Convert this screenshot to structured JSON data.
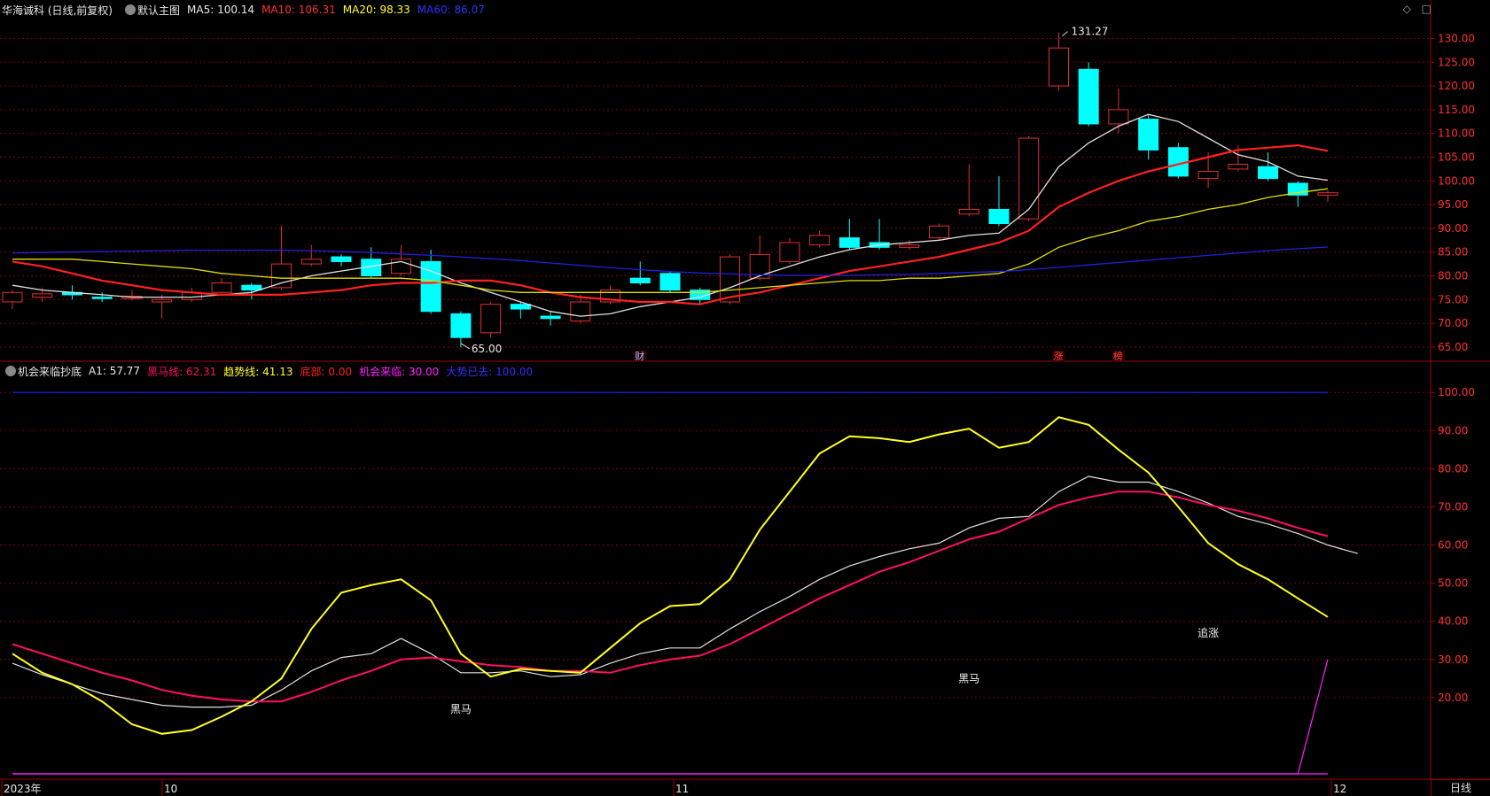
{
  "header": {
    "stock_title": "华海诚科 (日线,前复权)",
    "main_chart_label": "默认主图",
    "ma5": "MA5: 100.14",
    "ma10": "MA10: 106.31",
    "ma20": "MA20: 98.33",
    "ma60": "MA60: 86.07",
    "icons": [
      "diamond-icon",
      "square-icon"
    ]
  },
  "indicator": {
    "name": "机会来临抄底",
    "a1": "A1: 57.77",
    "heima": "黑马线: 62.31",
    "trend": "趋势线: 41.13",
    "bottom": "底部: 0.00",
    "chance": "机会来临: 30.00",
    "gone": "大势已去: 100.00"
  },
  "colors": {
    "bg": "#000000",
    "grid": "#7a0000",
    "axis": "#a00000",
    "up": "#e03030",
    "down": "#00ffff",
    "ma5": "#e0e0e0",
    "ma10": "#ff2020",
    "ma20": "#e0e000",
    "ma60": "#2020e0",
    "a1": "#e0e0e0",
    "heima": "#ff1060",
    "trend": "#ffff20",
    "chance": "#ff20ff",
    "gone": "#2020ff",
    "bottom_line": "#ff20ff"
  },
  "time_axis": {
    "labels": [
      "2023年",
      "10",
      "11",
      "12"
    ],
    "period_label": "日线"
  },
  "chart_data": [
    {
      "type": "candlestick",
      "title": "华海诚科 (日线,前复权)",
      "ylim": [
        62,
        134
      ],
      "y_ticks": [
        65,
        70,
        75,
        80,
        85,
        90,
        95,
        100,
        105,
        110,
        115,
        120,
        125,
        130
      ],
      "annotations": {
        "high": "131.27",
        "low": "65.00",
        "markers": [
          "财",
          "涨",
          "榜"
        ]
      },
      "candles": [
        {
          "o": 74.5,
          "c": 76.5,
          "h": 77,
          "l": 73
        },
        {
          "o": 75.5,
          "c": 76.2,
          "h": 77.5,
          "l": 74.5
        },
        {
          "o": 76.5,
          "c": 76,
          "h": 78,
          "l": 75
        },
        {
          "o": 75.5,
          "c": 75.2,
          "h": 76.5,
          "l": 74.5
        },
        {
          "o": 75.2,
          "c": 75.7,
          "h": 77,
          "l": 74.8
        },
        {
          "o": 74.5,
          "c": 75,
          "h": 76,
          "l": 71
        },
        {
          "o": 75,
          "c": 76.5,
          "h": 77.5,
          "l": 74.5
        },
        {
          "o": 76.5,
          "c": 78.5,
          "h": 79.5,
          "l": 76
        },
        {
          "o": 78,
          "c": 77,
          "h": 78.5,
          "l": 75
        },
        {
          "o": 77.5,
          "c": 82.5,
          "h": 90.5,
          "l": 77
        },
        {
          "o": 82.5,
          "c": 83.5,
          "h": 86.5,
          "l": 82
        },
        {
          "o": 84,
          "c": 83,
          "h": 84.5,
          "l": 82
        },
        {
          "o": 83.5,
          "c": 80,
          "h": 86,
          "l": 79.5
        },
        {
          "o": 80.5,
          "c": 83.5,
          "h": 86.5,
          "l": 80
        },
        {
          "o": 83,
          "c": 72.5,
          "h": 85.5,
          "l": 72
        },
        {
          "o": 72,
          "c": 67,
          "h": 72.5,
          "l": 65
        },
        {
          "o": 68,
          "c": 74,
          "h": 74.5,
          "l": 67
        },
        {
          "o": 74,
          "c": 73,
          "h": 74.5,
          "l": 71
        },
        {
          "o": 71.5,
          "c": 71,
          "h": 72.5,
          "l": 69.5
        },
        {
          "o": 70.5,
          "c": 74.5,
          "h": 76,
          "l": 70
        },
        {
          "o": 74.5,
          "c": 77,
          "h": 78,
          "l": 74
        },
        {
          "o": 79.5,
          "c": 78.5,
          "h": 83,
          "l": 78
        },
        {
          "o": 80.5,
          "c": 77,
          "h": 81,
          "l": 76.5
        },
        {
          "o": 77,
          "c": 75,
          "h": 77.5,
          "l": 74
        },
        {
          "o": 74.5,
          "c": 84,
          "h": 84.5,
          "l": 74
        },
        {
          "o": 79.5,
          "c": 84.5,
          "h": 88.5,
          "l": 79
        },
        {
          "o": 83,
          "c": 87,
          "h": 88,
          "l": 82.5
        },
        {
          "o": 86.5,
          "c": 88.5,
          "h": 89.5,
          "l": 86
        },
        {
          "o": 88,
          "c": 86,
          "h": 92,
          "l": 85.5
        },
        {
          "o": 87,
          "c": 86,
          "h": 92,
          "l": 85.5
        },
        {
          "o": 86,
          "c": 86.5,
          "h": 87.5,
          "l": 85.5
        },
        {
          "o": 88,
          "c": 90.5,
          "h": 91,
          "l": 87.5
        },
        {
          "o": 93,
          "c": 94,
          "h": 103.5,
          "l": 92.5
        },
        {
          "o": 94,
          "c": 91,
          "h": 101,
          "l": 90.5
        },
        {
          "o": 92,
          "c": 109,
          "h": 109.5,
          "l": 91.5
        },
        {
          "o": 120,
          "c": 128,
          "h": 131.27,
          "l": 119
        },
        {
          "o": 123.5,
          "c": 112,
          "h": 125,
          "l": 111.5
        },
        {
          "o": 112,
          "c": 115,
          "h": 119.5,
          "l": 110
        },
        {
          "o": 113,
          "c": 106.5,
          "h": 114,
          "l": 104.5
        },
        {
          "o": 107,
          "c": 101,
          "h": 108,
          "l": 100.5
        },
        {
          "o": 100.5,
          "c": 102,
          "h": 106,
          "l": 98.5
        },
        {
          "o": 102.5,
          "c": 103.5,
          "h": 107.5,
          "l": 102
        },
        {
          "o": 103,
          "c": 100.5,
          "h": 106,
          "l": 100
        },
        {
          "o": 99.5,
          "c": 97,
          "h": 100,
          "l": 94.5
        },
        {
          "o": 97,
          "c": 97.5,
          "h": 98,
          "l": 95.5
        }
      ],
      "series": [
        {
          "name": "MA5",
          "values": [
            78,
            77,
            76.5,
            76,
            75.5,
            75.5,
            75.5,
            76,
            76.5,
            78.5,
            80,
            81,
            82,
            83,
            81,
            78.5,
            76.5,
            74.5,
            72.5,
            71.5,
            72,
            73.5,
            74.5,
            75.5,
            77.5,
            80,
            82,
            84,
            85.5,
            86.5,
            87,
            87.5,
            88.5,
            89,
            94,
            103,
            108,
            111.5,
            114,
            112.5,
            109,
            105.5,
            104,
            101,
            100.14
          ]
        },
        {
          "name": "MA10",
          "values": [
            83,
            82,
            80.5,
            79,
            78,
            77,
            76.5,
            76,
            76,
            76,
            76.5,
            77,
            78,
            78.5,
            78.5,
            79,
            79,
            78,
            76.5,
            75.5,
            75,
            74.5,
            74.5,
            74,
            75.5,
            76.5,
            78,
            79.5,
            81,
            82,
            83,
            84,
            85.5,
            87,
            89.5,
            94.5,
            97.5,
            100,
            102,
            103.5,
            105,
            106.5,
            107,
            107.5,
            106.31
          ]
        },
        {
          "name": "MA20",
          "values": [
            83.5,
            83.5,
            83.5,
            83,
            82.5,
            82,
            81.5,
            80.5,
            80,
            79.5,
            79.5,
            79.5,
            79.5,
            79.5,
            79,
            78,
            77,
            76.5,
            76.5,
            76.5,
            76.5,
            76.5,
            76.5,
            76.5,
            77,
            77.5,
            78,
            78.5,
            79,
            79,
            79.5,
            79.5,
            80,
            80.5,
            82.5,
            86,
            88,
            89.5,
            91.5,
            92.5,
            94,
            95,
            96.5,
            97.5,
            98.33
          ]
        },
        {
          "name": "MA60",
          "values": [
            84.8,
            84.9,
            85,
            85.1,
            85.2,
            85.3,
            85.4,
            85.4,
            85.4,
            85.4,
            85.3,
            85.1,
            84.9,
            84.6,
            84.3,
            84,
            83.6,
            83.2,
            82.7,
            82.2,
            81.7,
            81.3,
            80.9,
            80.6,
            80.4,
            80.2,
            80.1,
            80.1,
            80.1,
            80.2,
            80.3,
            80.5,
            80.7,
            80.9,
            81.3,
            81.8,
            82.3,
            82.8,
            83.3,
            83.8,
            84.3,
            84.8,
            85.3,
            85.7,
            86.07
          ]
        }
      ]
    },
    {
      "type": "line",
      "title": "机会来临抄底",
      "ylim": [
        0,
        104
      ],
      "y_ticks": [
        20,
        30,
        40,
        50,
        60,
        70,
        80,
        90,
        100
      ],
      "annotations": [
        {
          "text": "黑马",
          "x": 15,
          "y": 16
        },
        {
          "text": "黑马",
          "x": 32,
          "y": 24
        },
        {
          "text": "追涨",
          "x": 40,
          "y": 36
        }
      ],
      "series": [
        {
          "name": "A1",
          "values": [
            29,
            26,
            23.5,
            21,
            19.5,
            18,
            17.5,
            17.5,
            18,
            22,
            27,
            30.5,
            31.5,
            35.5,
            31.5,
            26.5,
            26.5,
            27,
            25.5,
            26,
            29,
            31.5,
            33,
            33,
            38,
            42.5,
            46.5,
            51,
            54.5,
            57,
            59,
            60.5,
            64.5,
            67,
            67.5,
            74,
            78,
            76.5,
            76.5,
            74,
            71,
            67.5,
            65.5,
            63,
            60,
            57.77
          ]
        },
        {
          "name": "黑马线",
          "values": [
            34,
            31.5,
            29,
            26.5,
            24.5,
            22,
            20.5,
            19.5,
            19,
            19,
            21.5,
            24.5,
            27,
            30,
            30.5,
            29.5,
            28.5,
            28,
            27,
            27,
            26.5,
            28.5,
            30,
            31,
            34,
            38,
            42,
            46,
            49.5,
            53,
            55.5,
            58.5,
            61.5,
            63.5,
            67,
            70.5,
            72.5,
            74,
            74,
            72.5,
            70.5,
            69,
            67,
            64.5,
            62.31
          ]
        },
        {
          "name": "趋势线",
          "values": [
            31.5,
            26.5,
            23.5,
            19,
            13,
            10.5,
            11.5,
            15,
            19,
            25,
            38,
            47.5,
            49.5,
            51,
            45.5,
            31.5,
            25.5,
            27.5,
            27,
            26.5,
            33,
            39.5,
            44,
            44.5,
            51,
            64,
            74,
            84,
            88.5,
            88,
            87,
            89,
            90.5,
            85.5,
            87,
            93.5,
            91.5,
            85,
            79,
            70,
            60.5,
            55,
            51,
            46,
            41.13
          ]
        },
        {
          "name": "机会来临",
          "values": [
            0,
            0,
            0,
            0,
            0,
            0,
            0,
            0,
            0,
            0,
            0,
            0,
            0,
            0,
            0,
            0,
            0,
            0,
            0,
            0,
            0,
            0,
            0,
            0,
            0,
            0,
            0,
            0,
            0,
            0,
            0,
            0,
            0,
            0,
            0,
            0,
            0,
            0,
            0,
            0,
            0,
            0,
            0,
            0,
            30
          ]
        },
        {
          "name": "大势已去",
          "values": [
            100,
            100,
            100,
            100,
            100,
            100,
            100,
            100,
            100,
            100,
            100,
            100,
            100,
            100,
            100,
            100,
            100,
            100,
            100,
            100,
            100,
            100,
            100,
            100,
            100,
            100,
            100,
            100,
            100,
            100,
            100,
            100,
            100,
            100,
            100,
            100,
            100,
            100,
            100,
            100,
            100,
            100,
            100,
            100,
            100
          ]
        },
        {
          "name": "底部",
          "values": [
            0,
            0,
            0,
            0,
            0,
            0,
            0,
            0,
            0,
            0,
            0,
            0,
            0,
            0,
            0,
            0,
            0,
            0,
            0,
            0,
            0,
            0,
            0,
            0,
            0,
            0,
            0,
            0,
            0,
            0,
            0,
            0,
            0,
            0,
            0,
            0,
            0,
            0,
            0,
            0,
            0,
            0,
            0,
            0,
            0
          ]
        }
      ]
    }
  ]
}
